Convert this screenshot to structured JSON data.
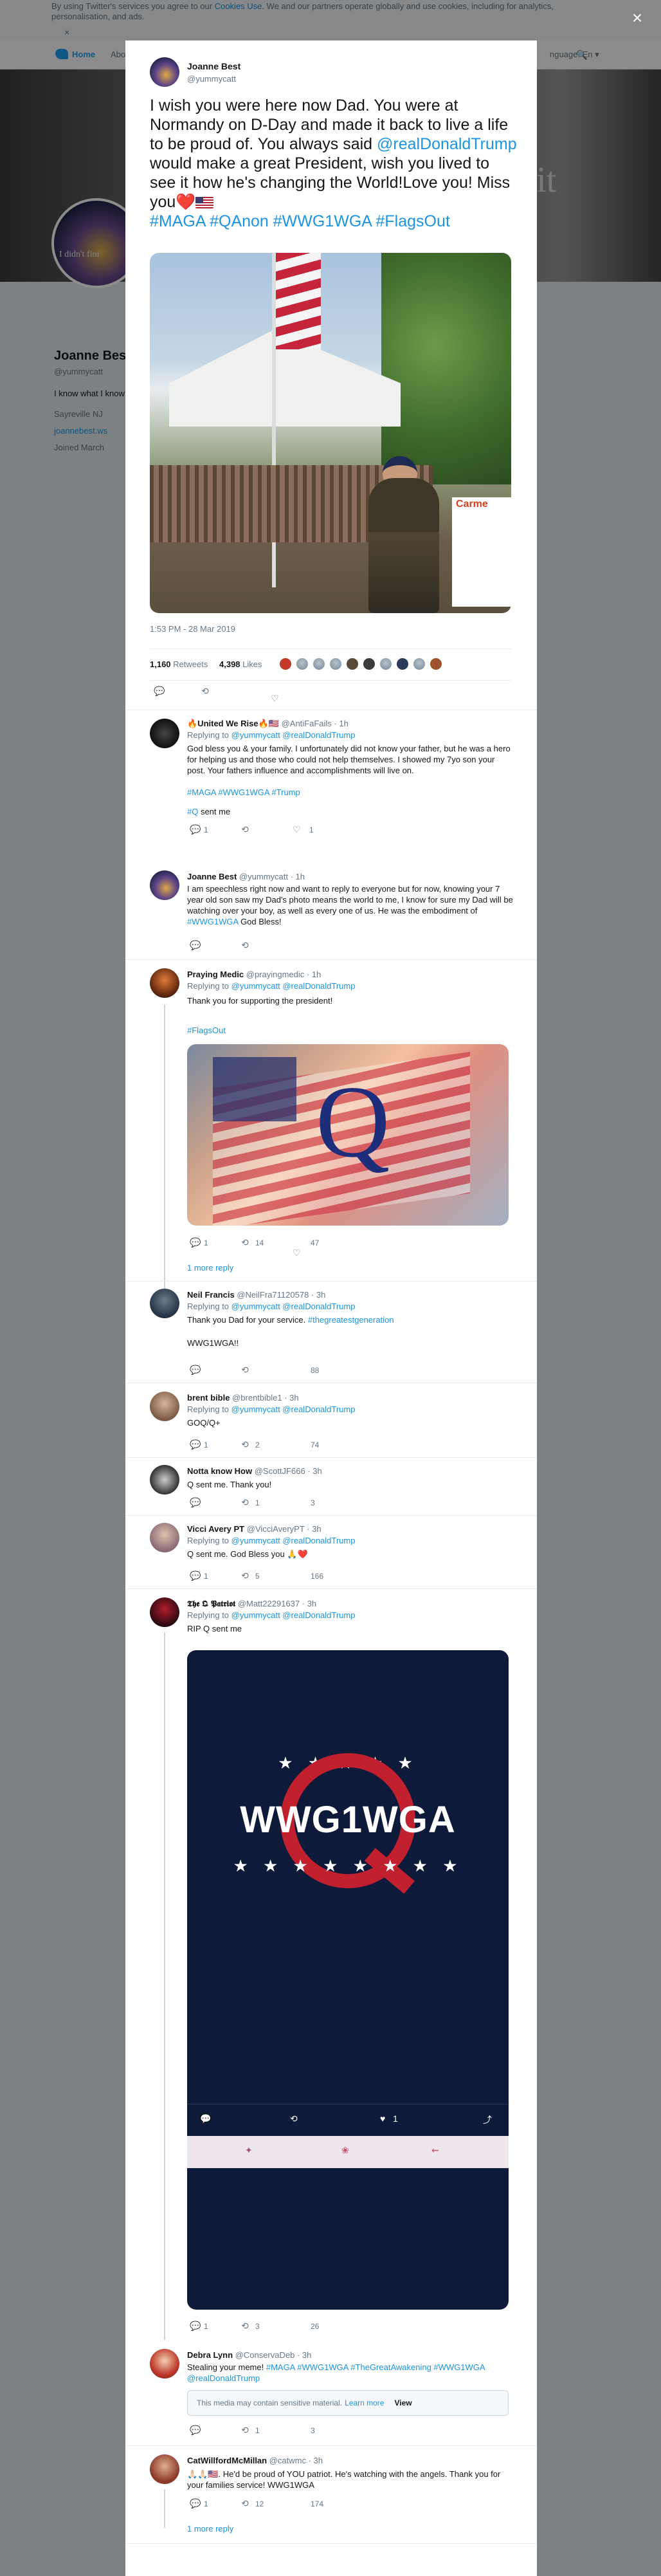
{
  "cookie": {
    "text_before": "By using Twitter's services you agree to our ",
    "link": "Cookies Use",
    "text_after": ". We and our partners operate globally and use cookies, including for analytics, personalisation, and ads.",
    "close": "×"
  },
  "nav": {
    "home": "Home",
    "about": "Abo",
    "language": "nguage: En ▾",
    "search": "🔍"
  },
  "banner": {
    "overlay_text": "if it",
    "left_text": "I didn't fini"
  },
  "profile": {
    "name": "Joanne Bes",
    "handle": "@yummycatt",
    "bio": "I know what I know",
    "location": "Sayreville NJ",
    "website": "joannebest.ws",
    "joined": "Joined March"
  },
  "overlay_close": "×",
  "main_tweet": {
    "name": "Joanne Best",
    "handle": "@yummycatt",
    "text_1": "I wish you were here now Dad. You were at Normandy on D-Day and made it back to live a life to be proud of. You always said ",
    "mention": "@realDonaldTrump",
    "text_2": " would make a great President, wish you lived to see it how he's changing the World!Love you! Miss you",
    "hashtags": "#MAGA #QAnon #WWG1WGA #FlagsOut",
    "photo_sign": "Carme",
    "timestamp": "1:53 PM - 28 Mar 2019",
    "retweets": "1,160",
    "retweets_label": "Retweets",
    "likes": "4,398",
    "likes_label": "Likes"
  },
  "icons": {
    "reply": "💬",
    "retweet": "⟲",
    "like": "♡",
    "more": "⌄",
    "share": "⤴"
  },
  "replies": [
    {
      "name": "🔥United We Rise🔥🇺🇸",
      "handle": "@AntiFaFails · 1h",
      "replying_label": "Replying to",
      "mentions": "@yummycatt @realDonaldTrump",
      "text": "God bless you & your family. I unfortunately did not know your father, but he was a hero for helping us and those who could not help themselves. I showed my 7yo son your post. Your fathers influence and accomplishments will live on.",
      "tags": "#MAGA #WWG1WGA #Trump",
      "tags2": "#Q",
      "tags2_after": " sent me",
      "counts": {
        "reply": "1",
        "retweet": "",
        "like": "1"
      }
    },
    {
      "name": "Joanne Best",
      "handle": "@yummycatt · 1h",
      "replying_label": "",
      "mentions": "",
      "text_1": "I am speechless right now and want to reply to everyone but for now, knowing your 7 year old son saw my Dad's photo means the world to me, I know for sure my Dad will be watching over your boy, as well as every one of us. He was the embodiment of ",
      "tag": "#WWG1WGA",
      "text_2": " God Bless!",
      "counts": {
        "reply": "",
        "retweet": "",
        "like": ""
      }
    },
    {
      "name": "Praying Medic",
      "handle": "@prayingmedic · 1h",
      "replying_label": "Replying to",
      "mentions": "@yummycatt @realDonaldTrump",
      "text": "Thank you for supporting the president!",
      "tags": "#FlagsOut",
      "image_letter": "Q",
      "counts": {
        "reply": "1",
        "retweet": "14",
        "like": "47"
      },
      "more": "1 more reply"
    },
    {
      "name": "Neil Francis",
      "handle": "@NeilFra71120578 · 3h",
      "replying_label": "Replying to",
      "mentions": "@yummycatt @realDonaldTrump",
      "text_1": "Thank you Dad for your service. ",
      "tag": "#thegreatestgeneration",
      "text_2": "WWG1WGA!!",
      "counts": {
        "reply": "",
        "retweet": "",
        "like": "88"
      }
    },
    {
      "name": "brent bible",
      "handle": "@brentbible1 · 3h",
      "replying_label": "Replying to",
      "mentions": "@yummycatt @realDonaldTrump",
      "text": "GOQ/Q+",
      "counts": {
        "reply": "1",
        "retweet": "2",
        "like": "74"
      }
    },
    {
      "name": "Notta know How",
      "handle": "@ScottJF666 · 3h",
      "replying_label": "",
      "mentions": "",
      "text": "Q sent me. Thank you!",
      "counts": {
        "reply": "",
        "retweet": "1",
        "like": "3"
      }
    },
    {
      "name": "Vicci Avery PT",
      "handle": "@VicciAveryPT · 3h",
      "replying_label": "Replying to",
      "mentions": "@yummycatt @realDonaldTrump",
      "text": "Q sent me. God Bless you 🙏❤️",
      "counts": {
        "reply": "1",
        "retweet": "5",
        "like": "166"
      }
    },
    {
      "name": "𝕿𝖍𝖊 𝕼 𝕻𝖆𝖙𝖗𝖎𝖔𝖙",
      "handle": "@Matt22291637 · 3h",
      "replying_label": "Replying to",
      "mentions": "@yummycatt @realDonaldTrump",
      "text": "RIP Q sent me",
      "image_text": "WWG1WGA",
      "stars": "★ ★ ★ ★ ★",
      "stars_bottom": "★ ★ ★ ★ ★ ★ ★ ★",
      "inner_like": "1",
      "counts": {
        "reply": "1",
        "retweet": "3",
        "like": "26"
      }
    },
    {
      "name": "Debra Lynn",
      "handle": "@ConservaDeb · 3h",
      "replying_label": "",
      "mentions": "",
      "text_1": "Stealing your meme! ",
      "tags": "#MAGA #WWG1WGA #TheGreatAwakening #WWG1WGA",
      "tags_2": "@realDonaldTrump",
      "sensitive": "This media may contain sensitive material.",
      "learn": "Learn more",
      "view": "View",
      "counts": {
        "reply": "",
        "retweet": "1",
        "like": "3"
      }
    },
    {
      "name": "CatWillfordMcMillan",
      "handle": "@catwmc · 3h",
      "replying_label": "",
      "mentions": "",
      "text": "🙏🏻🙏🏻🇺🇸. He'd be proud of YOU patriot. He's watching with the angels. Thank you for your families service! WWG1WGA",
      "counts": {
        "reply": "1",
        "retweet": "12",
        "like": "174"
      },
      "more": "1 more reply"
    }
  ]
}
